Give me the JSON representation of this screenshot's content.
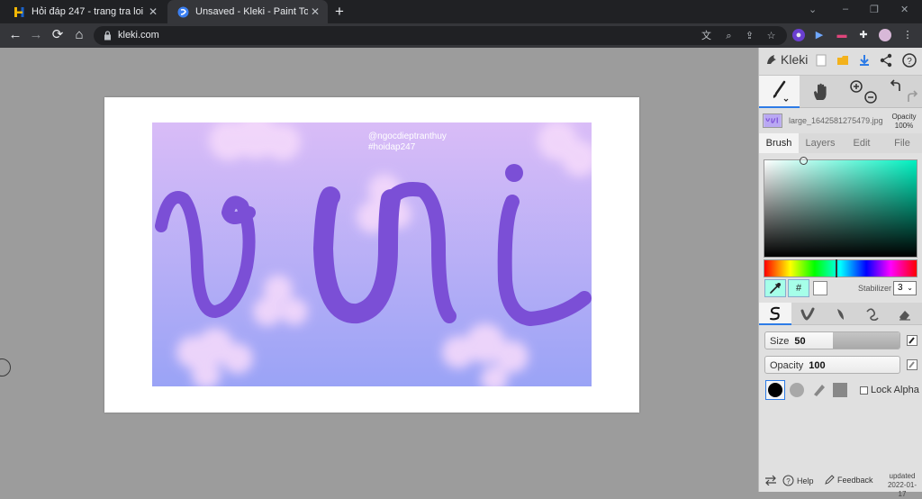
{
  "browser": {
    "tabs": [
      {
        "title": "Hỏi đáp 247 - trang tra loi",
        "favicon": "hoidap-favicon",
        "active": false
      },
      {
        "title": "Unsaved - Kleki - Paint Tool",
        "favicon": "kleki-favicon",
        "active": true
      }
    ],
    "url": "kleki.com",
    "new_tab_label": "+",
    "window_controls": [
      "⌄",
      "–",
      "❐",
      "✕"
    ]
  },
  "artwork": {
    "watermark_line1": "@ngocdieptranthuy",
    "watermark_line2": "#hoidap247",
    "text_color": "#7b4fd6",
    "bg_top": "#d9bcf7",
    "bg_bottom": "#9aa3f6",
    "cloud_color": "#f4d9fb"
  },
  "panel": {
    "brand": "Kleki",
    "layer_file": "large_1642581275479.jpg",
    "opacity_label": "Opacity",
    "opacity_value": "100%",
    "tabs": [
      "Brush",
      "Layers",
      "Edit",
      "File"
    ],
    "active_tab": "Brush",
    "hex_label": "#",
    "stabilizer_label": "Stabilizer",
    "stabilizer_value": "3",
    "size_label": "Size",
    "size_value": "50",
    "size_level": 0.5,
    "opacity_slider_label": "Opacity",
    "opacity_slider_value": "100",
    "opacity_level": 1.0,
    "lock_alpha_label": "Lock Alpha",
    "footer": {
      "help": "Help",
      "feedback": "Feedback",
      "updated_label": "updated",
      "updated_date": "2022-01-17"
    },
    "colors": {
      "accent": "#2e7ce6",
      "picker_hue": "#00f0c0",
      "current_color": "#ffffff"
    }
  }
}
